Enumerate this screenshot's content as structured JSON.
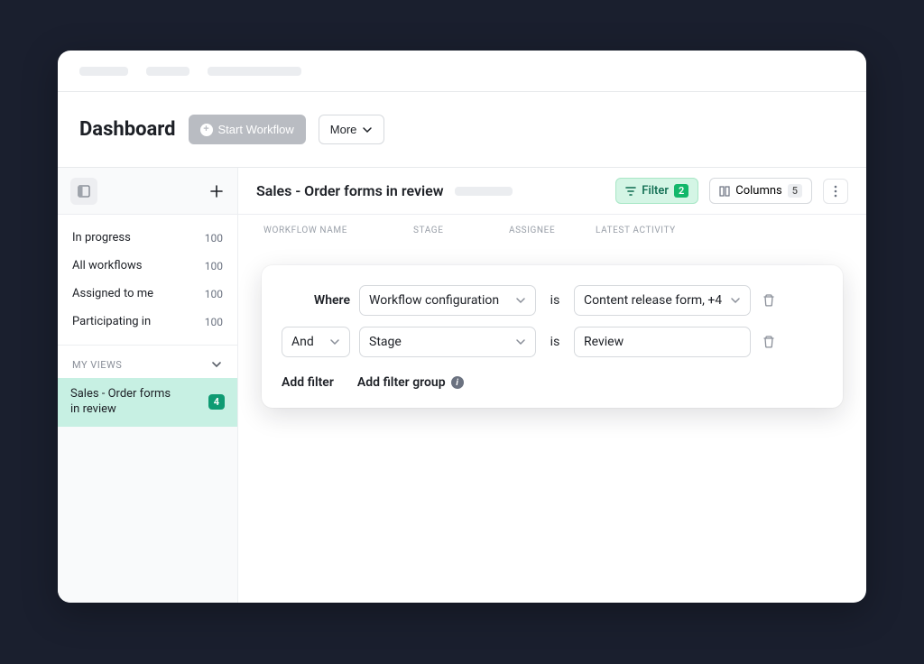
{
  "header": {
    "title": "Dashboard",
    "start_workflow": "Start Workflow",
    "more": "More"
  },
  "sidebar": {
    "nav": [
      {
        "label": "In progress",
        "count": "100"
      },
      {
        "label": "All workflows",
        "count": "100"
      },
      {
        "label": "Assigned to me",
        "count": "100"
      },
      {
        "label": "Participating in",
        "count": "100"
      }
    ],
    "views_heading": "My views",
    "views": [
      {
        "label": "Sales - Order forms in review",
        "count": "4",
        "active": true
      }
    ]
  },
  "main": {
    "view_title": "Sales - Order forms in review",
    "filter_label": "Filter",
    "filter_count": "2",
    "columns_label": "Columns",
    "columns_count": "5",
    "table_cols": [
      "Workflow name",
      "Stage",
      "Assignee",
      "Latest activity"
    ]
  },
  "filter_panel": {
    "where": "Where",
    "and": "And",
    "is": "is",
    "rows": [
      {
        "field": "Workflow configuration",
        "value": "Content release form, +4"
      },
      {
        "field": "Stage",
        "value": "Review"
      }
    ],
    "add_filter": "Add filter",
    "add_filter_group": "Add filter group"
  }
}
